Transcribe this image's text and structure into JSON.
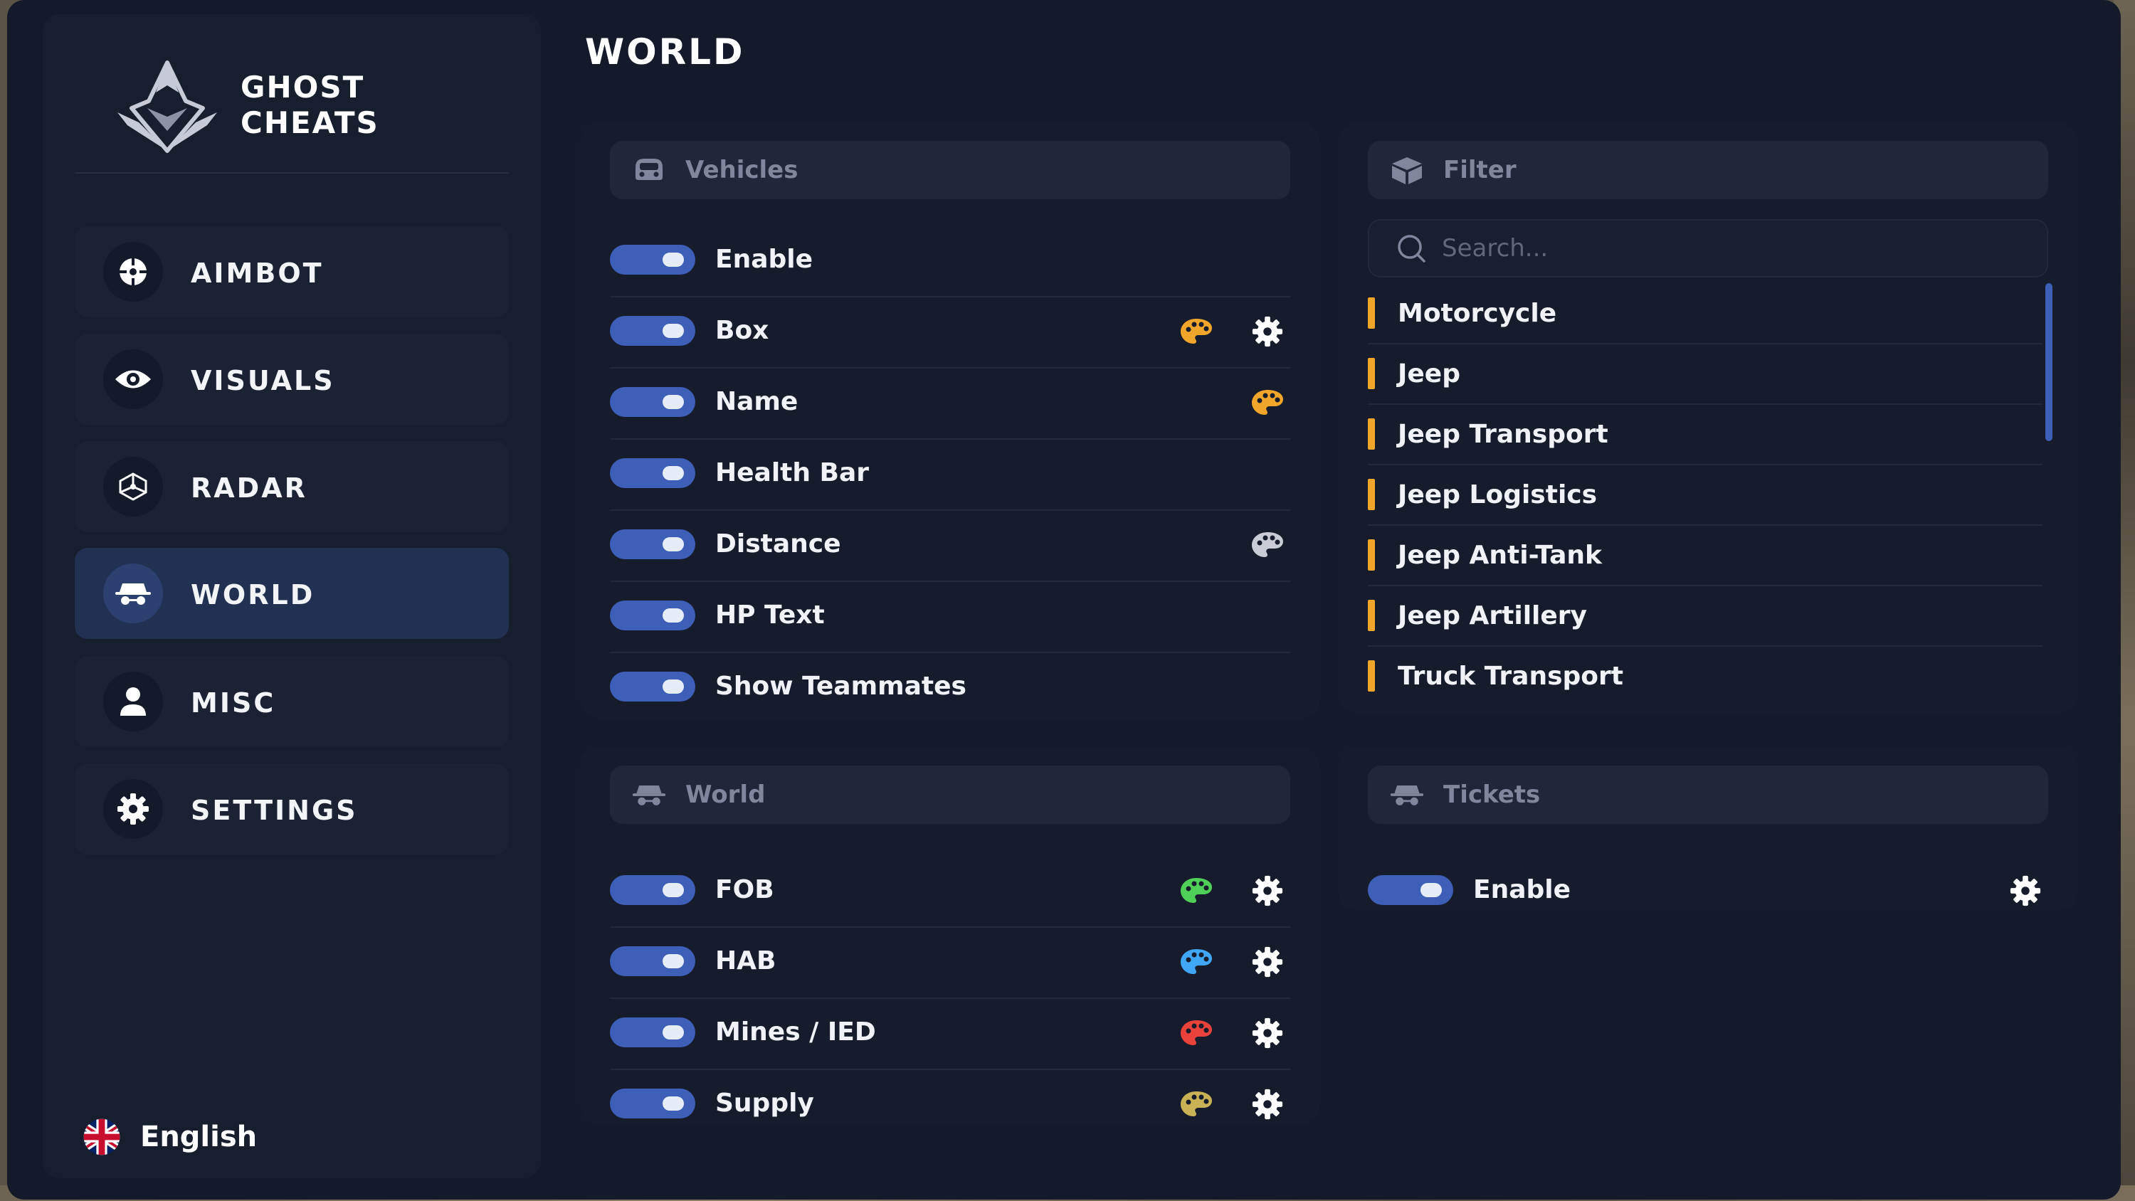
{
  "brand": {
    "line1": "GHOST",
    "line2": "CHEATS"
  },
  "nav": [
    {
      "label": "AIMBOT",
      "icon": "crosshair-icon",
      "active": false
    },
    {
      "label": "VISUALS",
      "icon": "eye-icon",
      "active": false
    },
    {
      "label": "RADAR",
      "icon": "radar-icon",
      "active": false
    },
    {
      "label": "WORLD",
      "icon": "spy-icon",
      "active": true
    },
    {
      "label": "MISC",
      "icon": "user-icon",
      "active": false
    },
    {
      "label": "SETTINGS",
      "icon": "gear-icon",
      "active": false
    }
  ],
  "language": {
    "label": "English",
    "icon": "uk-flag-icon"
  },
  "page_title": "WORLD",
  "vehicles": {
    "title": "Vehicles",
    "rows": [
      {
        "label": "Enable",
        "enabled": true
      },
      {
        "label": "Box",
        "enabled": true,
        "color": "#f0a62a",
        "settings": true
      },
      {
        "label": "Name",
        "enabled": true,
        "color": "#f0a62a"
      },
      {
        "label": "Health Bar",
        "enabled": true
      },
      {
        "label": "Distance",
        "enabled": true,
        "color": "#c9ccd4"
      },
      {
        "label": "HP Text",
        "enabled": true
      },
      {
        "label": "Show Teammates",
        "enabled": true
      }
    ]
  },
  "filter": {
    "title": "Filter",
    "search_placeholder": "Search...",
    "items": [
      "Motorcycle",
      "Jeep",
      "Jeep Transport",
      "Jeep Logistics",
      "Jeep Anti-Tank",
      "Jeep Artillery",
      "Truck Transport"
    ],
    "accent": "#f0a62a"
  },
  "world": {
    "title": "World",
    "rows": [
      {
        "label": "FOB",
        "enabled": true,
        "color": "#4fcf58",
        "settings": true
      },
      {
        "label": "HAB",
        "enabled": true,
        "color": "#3fa7f5",
        "settings": true
      },
      {
        "label": "Mines / IED",
        "enabled": true,
        "color": "#e8423b",
        "settings": true
      },
      {
        "label": "Supply",
        "enabled": true,
        "color": "#c9b155",
        "settings": true
      }
    ]
  },
  "tickets": {
    "title": "Tickets",
    "rows": [
      {
        "label": "Enable",
        "enabled": true,
        "settings": true
      }
    ]
  },
  "colors": {
    "toggle_on": "#3d5fb8",
    "active_nav": "#223152",
    "background": "#141a29"
  }
}
